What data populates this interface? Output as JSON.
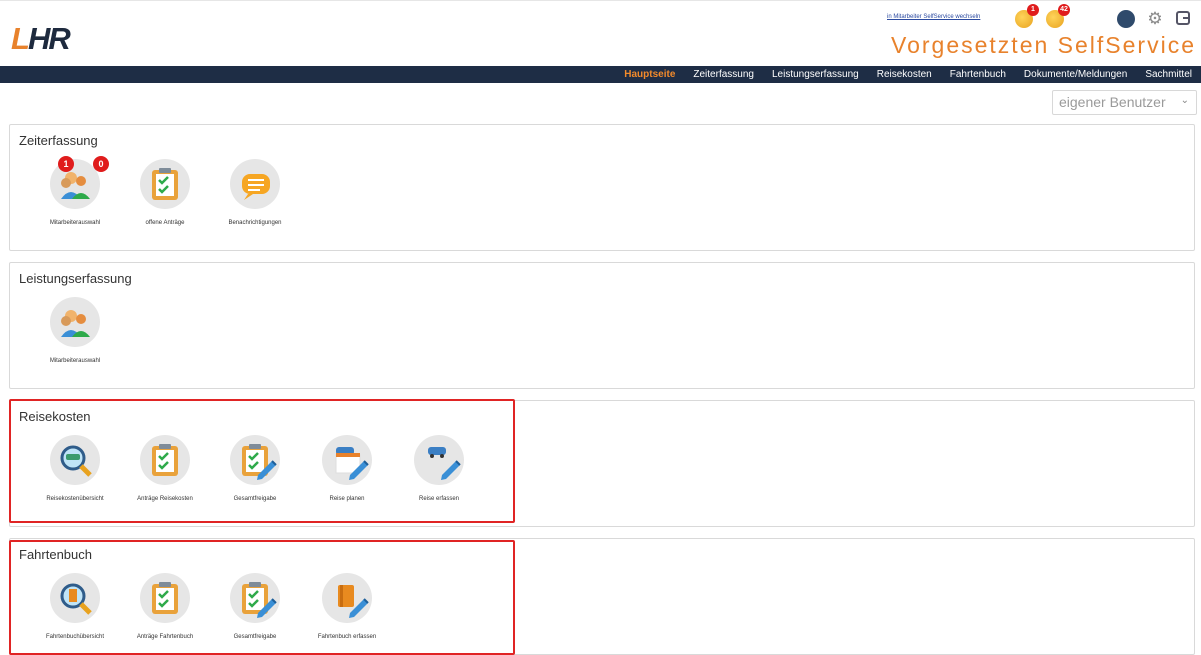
{
  "header": {
    "logo_l": "L",
    "logo_hr": "HR",
    "switch_link": "in Mitarbeiter SelfService wechseln",
    "app_title": "Vorgesetzten SelfService",
    "notif1_count": "1",
    "notif2_count": "42",
    "icons": [
      "bell-coin-icon",
      "coins-icon",
      "chat-icon",
      "gear-icon",
      "logout-icon"
    ]
  },
  "nav": {
    "items": [
      "Hauptseite",
      "Zeiterfassung",
      "Leistungserfassung",
      "Reisekosten",
      "Fahrtenbuch",
      "Dokumente/Meldungen",
      "Sachmittel"
    ],
    "active_index": 0
  },
  "user_select": {
    "value": "eigener Benutzer"
  },
  "sections": {
    "zeit": {
      "title": "Zeiterfassung",
      "tiles": [
        {
          "label": "Mitarbeiterauswahl",
          "icon": "employees-icon",
          "badge1": "1",
          "badge2": "0"
        },
        {
          "label": "offene Anträge",
          "icon": "clipboard-check-icon"
        },
        {
          "label": "Benachrichtigungen",
          "icon": "message-icon"
        }
      ]
    },
    "leistung": {
      "title": "Leistungserfassung",
      "tiles": [
        {
          "label": "Mitarbeiterauswahl",
          "icon": "employees-icon"
        }
      ]
    },
    "reise": {
      "title": "Reisekosten",
      "tiles": [
        {
          "label": "Reisekostenübersicht",
          "icon": "magnifier-car-icon"
        },
        {
          "label": "Anträge Reisekosten",
          "icon": "clipboard-check-icon"
        },
        {
          "label": "Gesamtfreigabe",
          "icon": "clipboard-pen-icon"
        },
        {
          "label": "Reise planen",
          "icon": "calendar-pen-icon"
        },
        {
          "label": "Reise erfassen",
          "icon": "car-pen-icon"
        }
      ]
    },
    "fahrt": {
      "title": "Fahrtenbuch",
      "tiles": [
        {
          "label": "Fahrtenbuchübersicht",
          "icon": "magnifier-book-icon"
        },
        {
          "label": "Anträge Fahrtenbuch",
          "icon": "clipboard-check-icon"
        },
        {
          "label": "Gesamtfreigabe",
          "icon": "clipboard-pen-icon"
        },
        {
          "label": "Fahrtenbuch erfassen",
          "icon": "book-pen-icon"
        }
      ]
    }
  },
  "colors": {
    "accent": "#e8822c",
    "navbar": "#1e2d45",
    "highlight_border": "#e02424",
    "badge": "#e01c1c"
  }
}
